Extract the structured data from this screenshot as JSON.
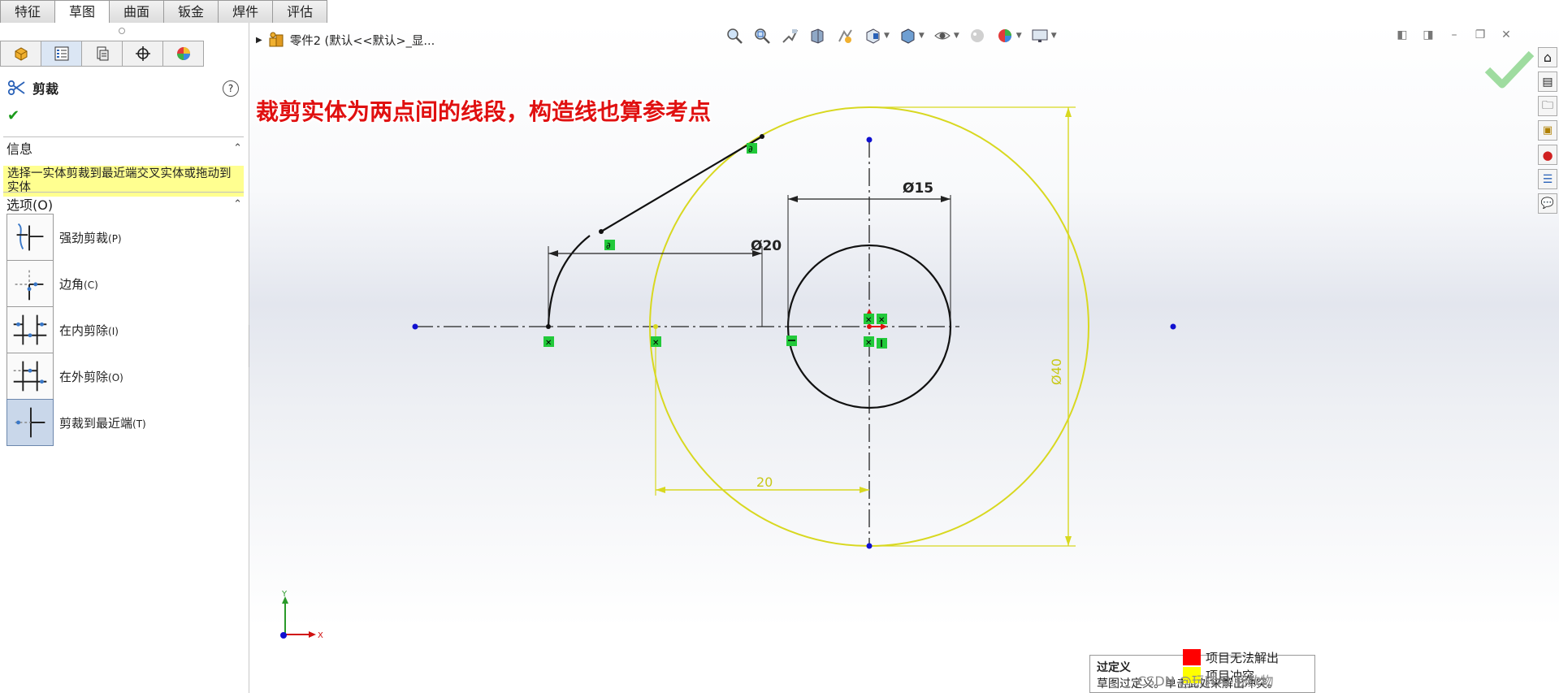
{
  "command_tabs": [
    {
      "label": "特征",
      "active": false
    },
    {
      "label": "草图",
      "active": true
    },
    {
      "label": "曲面",
      "active": false
    },
    {
      "label": "钣金",
      "active": false
    },
    {
      "label": "焊件",
      "active": false
    },
    {
      "label": "评估",
      "active": false
    }
  ],
  "manager_tabs": [
    "feature-manager-icon",
    "property-manager-icon",
    "configuration-manager-icon",
    "dimxpert-manager-icon",
    "display-manager-icon"
  ],
  "property_manager": {
    "title": "剪裁",
    "help_label": "?",
    "ok_label": "✔",
    "info_section": {
      "header": "信息",
      "text": "选择一实体剪裁到最近端交叉实体或拖动到实体"
    },
    "options_section": {
      "header": "选项(O)",
      "options": [
        {
          "label": "强劲剪裁",
          "key": "(P)",
          "icon": "power-trim-icon",
          "selected": false
        },
        {
          "label": "边角",
          "key": "(C)",
          "icon": "corner-trim-icon",
          "selected": false
        },
        {
          "label": "在内剪除",
          "key": "(I)",
          "icon": "trim-away-inside-icon",
          "selected": false
        },
        {
          "label": "在外剪除",
          "key": "(O)",
          "icon": "trim-away-outside-icon",
          "selected": false
        },
        {
          "label": "剪裁到最近端",
          "key": "(T)",
          "icon": "trim-to-closest-icon",
          "selected": true
        }
      ]
    }
  },
  "tree": {
    "part_label": "零件2 (默认<<默认>_显..."
  },
  "annotation": "裁剪实体为两点间的线段，构造线也算参考点",
  "dimensions": {
    "d15": "Ø15",
    "d20": "Ø20",
    "d40": "Ø40",
    "linear20": "20"
  },
  "status_tip": {
    "title": "过定义",
    "text": "草图过定义。单击此处来解出冲突。"
  },
  "legend": [
    {
      "label": "项目无法解出",
      "color": "#ff0000"
    },
    {
      "label": "项目冲突",
      "color": "#ffff00"
    }
  ],
  "watermark": "CSDN @玩转AI·畅数物",
  "colors": {
    "sketch": "#111111",
    "conflict": "#d8d820",
    "endpoint": "#1010d0",
    "relation": "#22c93a",
    "accent": "#e01010"
  }
}
